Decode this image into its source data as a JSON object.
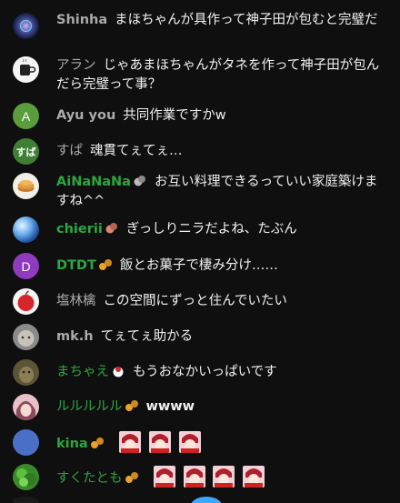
{
  "messages": [
    {
      "id": "m1",
      "author": "Shinha",
      "text": "まほちゃんが具作って神子田が包むと完璧だ",
      "avatar_icon": "galaxy-avatar-icon"
    },
    {
      "id": "m2",
      "author": "アラン",
      "text": "じゃあまほちゃんがタネを作って神子田が包んだら完璧って事？",
      "avatar_icon": "mug-avatar-icon"
    },
    {
      "id": "m3",
      "author": "Ayu you",
      "text": "共同作業ですかw",
      "avatar_letter": "A"
    },
    {
      "id": "m4",
      "author": "すぱ",
      "text": "魂貫てぇてぇ…",
      "avatar_letter": "すば"
    },
    {
      "id": "m5",
      "author": "AiNaNaNa",
      "text": "お互い料理できるっていい家庭築けますね^^",
      "avatar_icon": "pancake-avatar-icon",
      "badge_icon": "member-badge-icon"
    },
    {
      "id": "m6",
      "author": "chierii",
      "text": "ぎっしりニラだよね、たぶん",
      "avatar_icon": "sphere-avatar-icon",
      "badge_icon": "member-badge-icon"
    },
    {
      "id": "m7",
      "author": "DTDT",
      "text": "飯とお菓子で棲み分け……",
      "avatar_letter": "D",
      "badge_icon": "member-badge-icon"
    },
    {
      "id": "m8",
      "author": "塩林檎",
      "text": "この空間にずっと住んでいたい",
      "avatar_icon": "apple-avatar-icon"
    },
    {
      "id": "m9",
      "author": "mk.h",
      "text": "てぇてぇ助かる",
      "avatar_icon": "cat-avatar-icon"
    },
    {
      "id": "m10",
      "author": "まちゃえ",
      "text": "もうおなかいっぱいです",
      "avatar_icon": "animal-avatar-icon",
      "badge_icon": "member-badge-icon"
    },
    {
      "id": "m11",
      "author": "ルルルルル",
      "text": "wwww",
      "avatar_icon": "anime-avatar-icon",
      "badge_icon": "member-badge-icon"
    },
    {
      "id": "m12",
      "author": "kina",
      "text": "",
      "avatar_icon": "blue-avatar-icon",
      "badge_icon": "member-badge-icon",
      "emotes": 3
    },
    {
      "id": "m13",
      "author": "すくたとも",
      "text": "",
      "avatar_icon": "leaf-avatar-icon",
      "badge_icon": "member-badge-icon",
      "emotes": 4
    }
  ],
  "colors": {
    "background": "#0f0f0f",
    "author_default": "#aaaaaa",
    "author_member": "#2ba640",
    "text": "#f1f1f1"
  }
}
